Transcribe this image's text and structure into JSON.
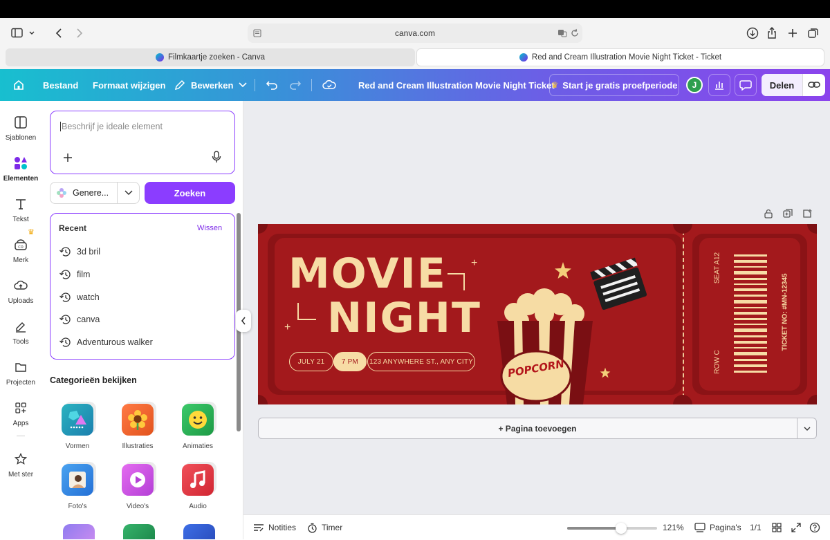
{
  "browser": {
    "url": "canva.com",
    "tabs": [
      {
        "title": "Filmkaartje zoeken - Canva",
        "active": false
      },
      {
        "title": "Red and Cream Illustration Movie Night Ticket - Ticket",
        "active": true
      }
    ]
  },
  "toolbar": {
    "file": "Bestand",
    "resize": "Formaat wijzigen",
    "edit": "Bewerken",
    "doc_title": "Red and Cream Illustration Movie Night Ticket",
    "trial": "Start je gratis proefperiode",
    "avatar_initial": "J",
    "share": "Delen"
  },
  "rail": {
    "items": [
      {
        "label": "Sjablonen",
        "icon": "layout-icon"
      },
      {
        "label": "Elementen",
        "icon": "shapes-icon",
        "active": true
      },
      {
        "label": "Tekst",
        "icon": "text-icon"
      },
      {
        "label": "Merk",
        "icon": "brand-icon"
      },
      {
        "label": "Uploads",
        "icon": "upload-cloud-icon"
      },
      {
        "label": "Tools",
        "icon": "pen-icon"
      },
      {
        "label": "Projecten",
        "icon": "folder-icon"
      },
      {
        "label": "Apps",
        "icon": "apps-icon"
      },
      {
        "label": "Met ster",
        "icon": "star-icon"
      }
    ]
  },
  "panel": {
    "prompt_placeholder": "Beschrijf je ideale element",
    "generate_label": "Genere...",
    "search_label": "Zoeken",
    "recent_title": "Recent",
    "clear_label": "Wissen",
    "recent": [
      "3d bril",
      "film",
      "watch",
      "canva",
      "Adventurous walker"
    ],
    "categories_title": "Categorieën bekijken",
    "categories": [
      "Vormen",
      "Illustraties",
      "Animaties",
      "Foto's",
      "Video's",
      "Audio"
    ]
  },
  "ticket": {
    "title_line1": "MOVIE",
    "title_line2": "NIGHT",
    "date": "JULY 21",
    "time": "7 PM",
    "address": "123 ANYWHERE ST., ANY CITY",
    "popcorn": "POPCORN",
    "seat": "SEAT A12",
    "row": "ROW C",
    "ticket_no": "TICKET NO: #MN-12345"
  },
  "canvas": {
    "add_page": "+ Pagina toevoegen"
  },
  "bottombar": {
    "notes": "Notities",
    "timer": "Timer",
    "zoom": "121%",
    "zoom_fraction": 0.6,
    "pages": "Pagina's",
    "page_count": "1/1"
  },
  "colors": {
    "canva_purple": "#8b3dff",
    "ticket_red": "#a3191c",
    "ticket_cream": "#f7dca5"
  }
}
